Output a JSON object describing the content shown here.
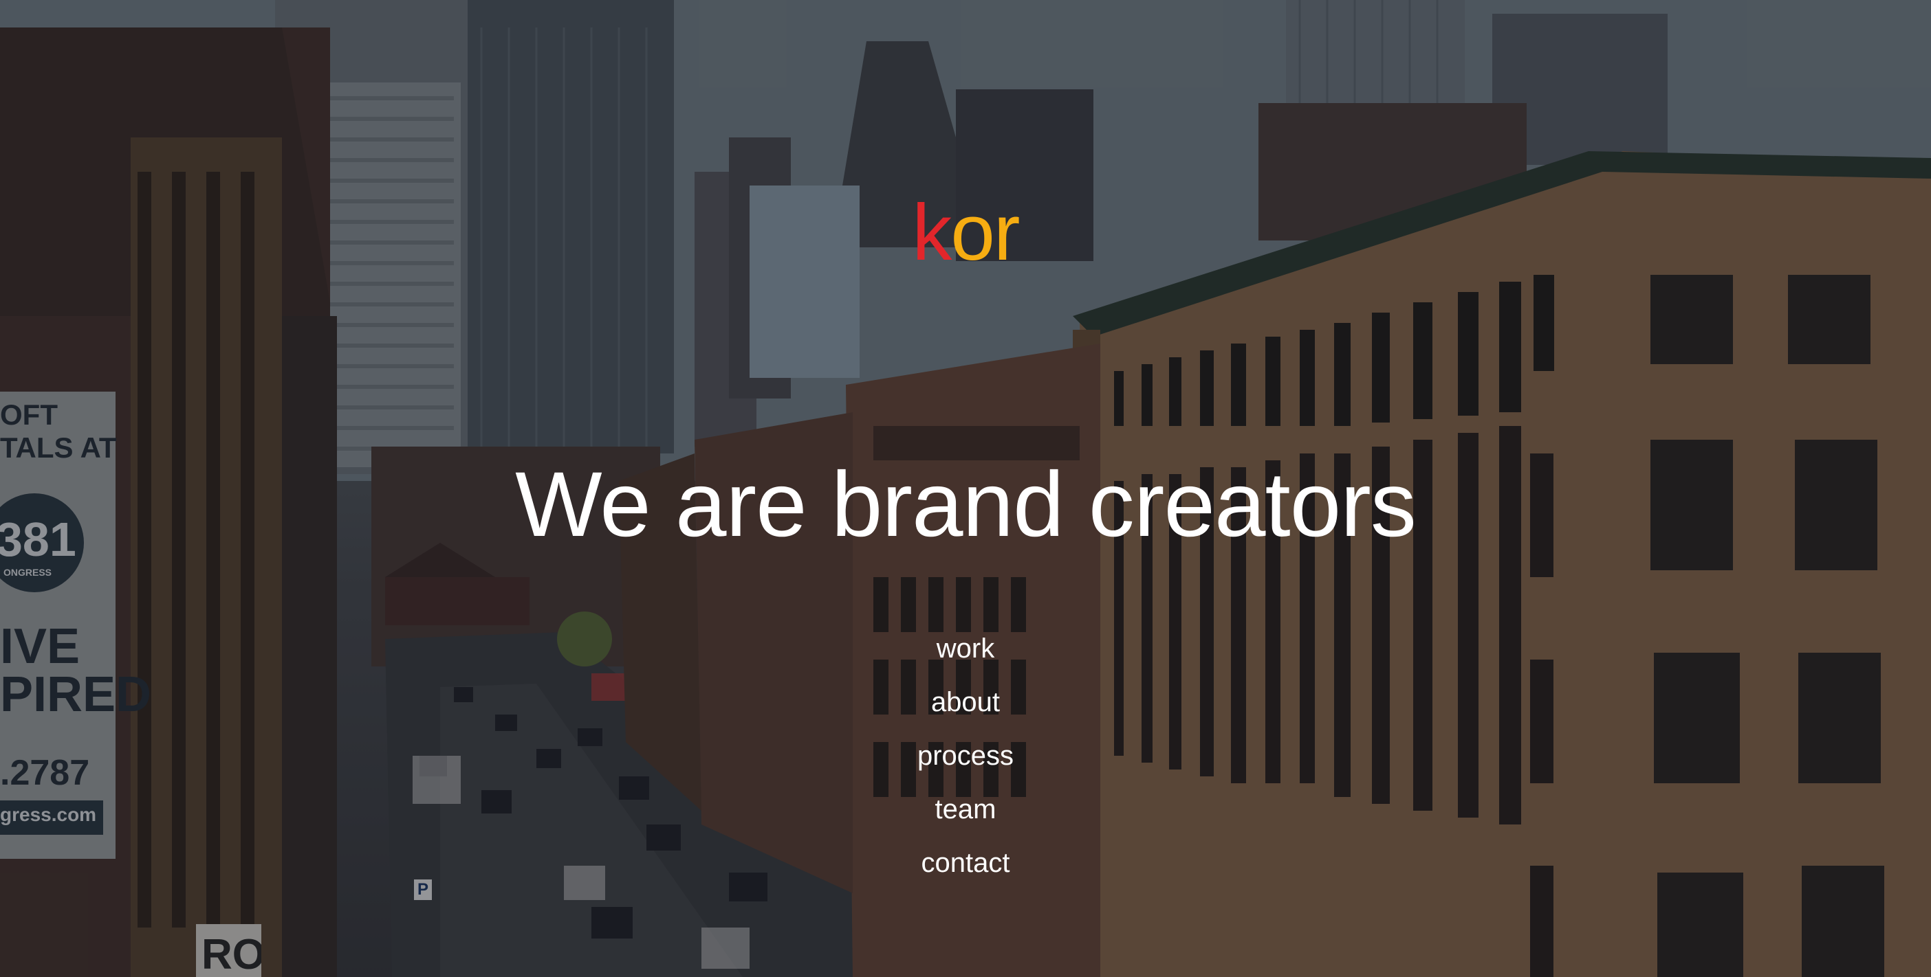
{
  "logo": {
    "first_letter": "k",
    "rest": "or",
    "colors": {
      "first_letter": "#e2262b",
      "rest": "#f6ad12"
    }
  },
  "hero": {
    "headline": "We are brand creators"
  },
  "nav": {
    "items": [
      {
        "label": "work"
      },
      {
        "label": "about"
      },
      {
        "label": "process"
      },
      {
        "label": "team"
      },
      {
        "label": "contact"
      }
    ]
  },
  "background": {
    "description_icon": "city-street-photo",
    "billboard_text": {
      "line1": "OFT",
      "line2": "TALS AT",
      "badge": "381",
      "badge_sub": "ONGRESS",
      "line3": "IVE",
      "line4": "PIRED",
      "phone": ".2787",
      "url": "gress.com"
    },
    "parking_sign": "P",
    "bottom_sign": "RO"
  }
}
